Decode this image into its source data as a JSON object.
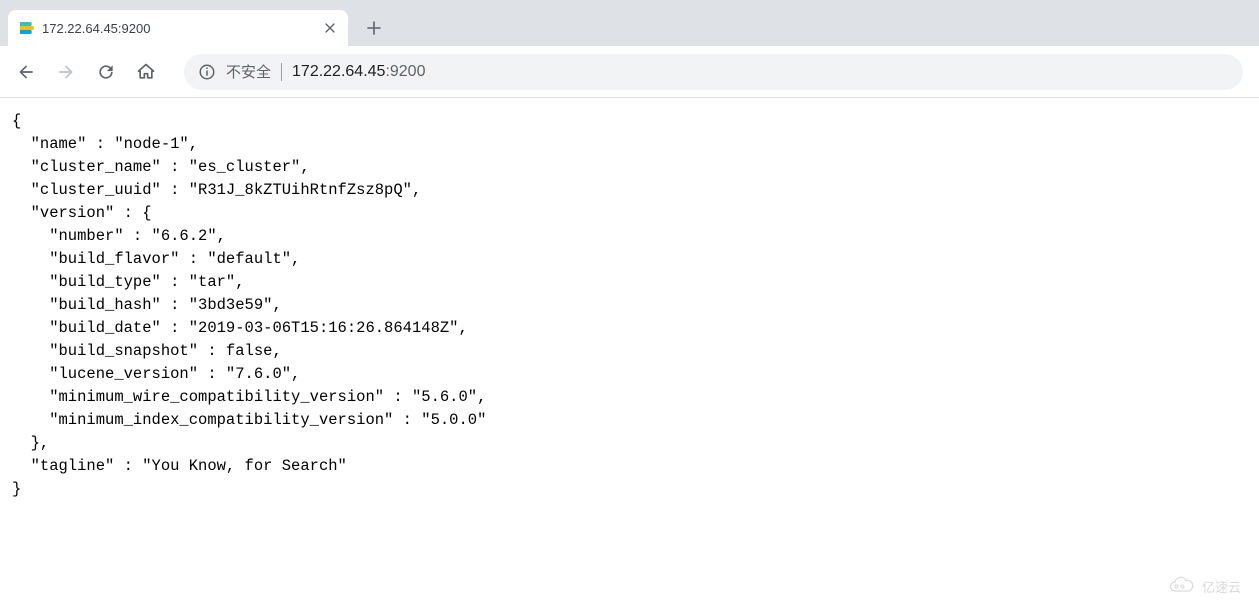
{
  "tab": {
    "title": "172.22.64.45:9200"
  },
  "toolbar": {
    "security_text": "不安全",
    "url_host": "172.22.64.45",
    "url_port": ":9200"
  },
  "response": {
    "name": "node-1",
    "cluster_name": "es_cluster",
    "cluster_uuid": "R31J_8kZTUihRtnfZsz8pQ",
    "version": {
      "number": "6.6.2",
      "build_flavor": "default",
      "build_type": "tar",
      "build_hash": "3bd3e59",
      "build_date": "2019-03-06T15:16:26.864148Z",
      "build_snapshot": "false",
      "lucene_version": "7.6.0",
      "minimum_wire_compatibility_version": "5.6.0",
      "minimum_index_compatibility_version": "5.0.0"
    },
    "tagline": "You Know, for Search"
  },
  "watermark": {
    "text": "亿速云"
  }
}
